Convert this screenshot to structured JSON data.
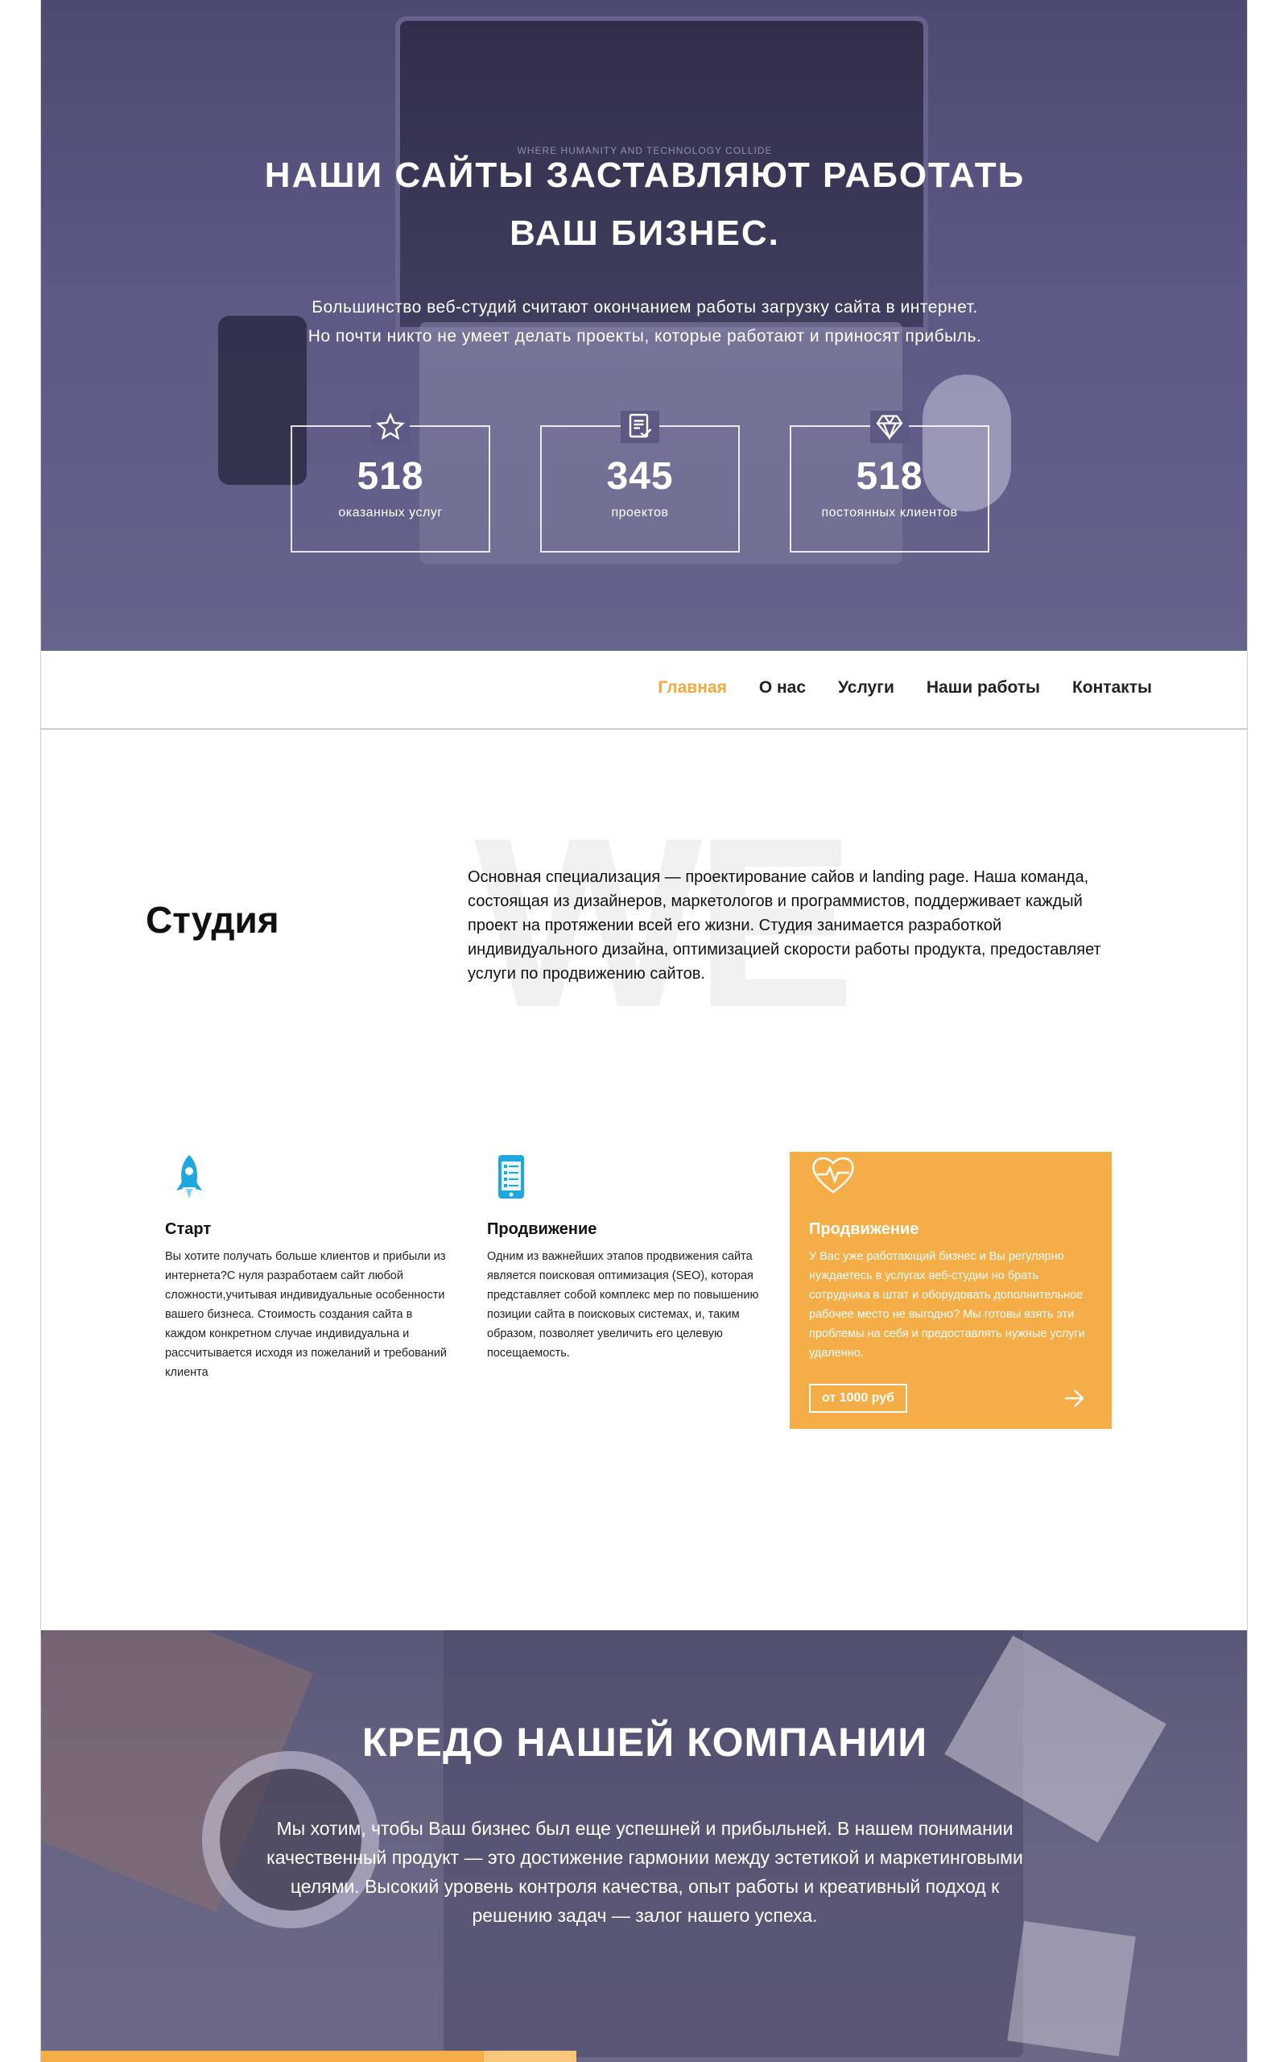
{
  "hero": {
    "screen_caption": "WHERE HUMANITY AND TECHNOLOGY COLLIDE",
    "title_line1": "НАШИ САЙТЫ ЗАСТАВЛЯЮТ РАБОТАТЬ",
    "title_line2": "ВАШ БИЗНЕС.",
    "lead": "Большинство веб-студий считают окончанием работы загрузку сайта в интернет. Но почти никто не умеет делать проекты, которые работают и приносят прибыль.",
    "stats": [
      {
        "icon": "star-icon",
        "value": "518",
        "label": "оказанных услуг"
      },
      {
        "icon": "document-check-icon",
        "value": "345",
        "label": "проектов"
      },
      {
        "icon": "diamond-icon",
        "value": "518",
        "label": "постоянных клиентов"
      }
    ]
  },
  "nav": {
    "items": [
      {
        "label": "Главная",
        "active": true
      },
      {
        "label": "О нас",
        "active": false
      },
      {
        "label": "Услуги",
        "active": false
      },
      {
        "label": "Наши работы",
        "active": false
      },
      {
        "label": "Контакты",
        "active": false
      }
    ],
    "active_color": "#f3a93b"
  },
  "studio": {
    "watermark": "WE",
    "title": "Студия",
    "text": "Основная специализация — проектирование сайов и landing page. Наша команда, состоящая из дизайнеров, маркетологов и программистов, поддерживает каждый проект на протяжении всей его жизни. Студия занимается разработкой индивидуального дизайна, оптимизацией скорости работы продукта, предоставляет услуги по продвижению сайтов."
  },
  "services": [
    {
      "icon": "rocket-icon",
      "title": "Старт",
      "text": "Вы хотите получать больше клиентов и прибыли из интернета?С нуля разработаем сайт любой сложности,учитывая индивидуальные особенности вашего бизнеса. Стоимость создания сайта в каждом конкретном случае индивидуальна и рассчитывается исходя из пожеланий и требований клиента"
    },
    {
      "icon": "mobile-checklist-icon",
      "title": "Продвижение",
      "text": "Одним из важнейших этапов продвижения сайта является поисковая оптимизация (SEO), которая представляет собой комплекс мер по повышению позиции сайта в поисковых системах, и, таким образом, позволяет увеличить его целевую посещаемость."
    },
    {
      "icon": "heart-pulse-icon",
      "title": "Продвижение",
      "text": "У Вас уже работающий бизнес и Вы регулярно нуждаетесь в услугах веб-студии но брать сотрудника в штат и оборудовать дополнительное рабочее место не выгодно? Мы готовы взять эти проблемы на себя и предоставлять нужные услуги удаленно.",
      "price_button": "от 1000 руб",
      "accent_color": "#f5ad47"
    }
  ],
  "credo": {
    "title": "КРЕДО НАШЕЙ КОМПАНИИ",
    "text": "Мы хотим, чтобы Ваш бизнес был еще успешней и прибыльней. В нашем понимании качественный продукт — это достижение гармонии между эстетикой и маркетинговыми целями. Высокий уровень контроля качества, опыт работы и креативный подход к решению задач — залог нашего успеха."
  },
  "colors": {
    "hero_overlay": "#5c5a85",
    "accent": "#f5ad47"
  }
}
